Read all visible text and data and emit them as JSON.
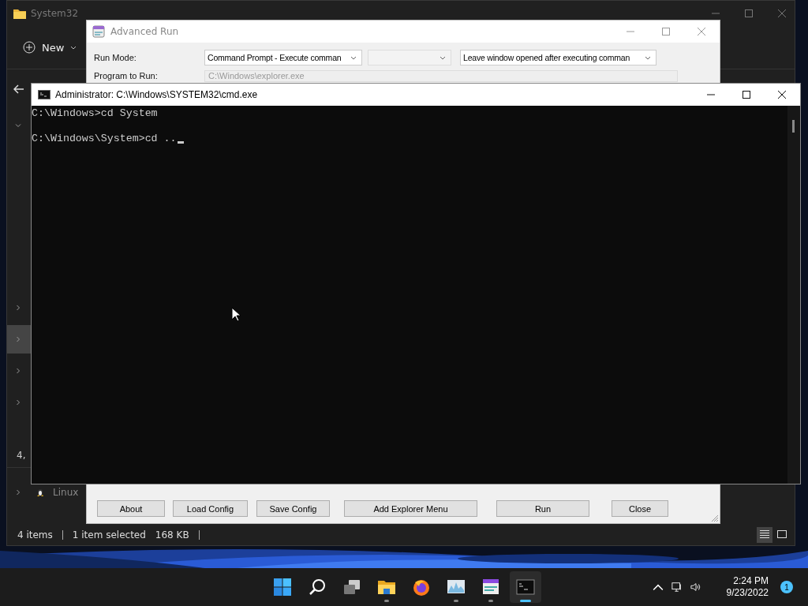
{
  "explorer": {
    "title": "System32",
    "toolbar": {
      "new_label": "New"
    },
    "nav_rows": [
      {
        "expanded": true,
        "selected": false
      },
      {
        "expanded": false,
        "selected": false
      },
      {
        "expanded": false,
        "selected": true
      },
      {
        "expanded": false,
        "selected": false
      },
      {
        "expanded": false,
        "selected": false
      }
    ],
    "size_fragment": "4,",
    "drive_row": {
      "label": "Linux",
      "expanded": false
    },
    "status_bar": {
      "count": "4 items",
      "selection": "1 item selected",
      "size": "168 KB"
    },
    "view_buttons": [
      {
        "kind": "details",
        "selected": true
      },
      {
        "kind": "tiles",
        "selected": false
      }
    ]
  },
  "advanced_run": {
    "title": "Advanced Run",
    "run_mode_label": "Run Mode:",
    "combos": [
      {
        "value": "Command Prompt - Execute comman",
        "disabled": false
      },
      {
        "disabled": true
      },
      {
        "value": "Leave window opened after executing comman",
        "disabled": false
      }
    ],
    "program_label": "Program to Run:",
    "program_value": "C:\\Windows\\explorer.exe",
    "buttons": [
      "About",
      "Load Config",
      "Save Config",
      "Add Explorer Menu",
      "Run",
      "Close"
    ]
  },
  "cmd": {
    "title": "Administrator: C:\\Windows\\SYSTEM32\\cmd.exe",
    "lines": [
      "C:\\Windows>cd System",
      "C:\\Windows\\System>cd .."
    ]
  },
  "taskbar": {
    "apps": [
      {
        "kind": "start",
        "running": false,
        "active": false
      },
      {
        "kind": "search",
        "running": false,
        "active": false
      },
      {
        "kind": "taskview",
        "running": false,
        "active": false
      },
      {
        "kind": "explorer",
        "running": true,
        "active": false
      },
      {
        "kind": "firefox",
        "running": false,
        "active": false
      },
      {
        "kind": "monitor",
        "running": true,
        "active": false
      },
      {
        "kind": "advrun",
        "running": true,
        "active": false
      },
      {
        "kind": "cmd",
        "running": true,
        "active": true
      }
    ],
    "time": "2:24 PM",
    "date": "9/23/2022",
    "notifications": "1"
  }
}
